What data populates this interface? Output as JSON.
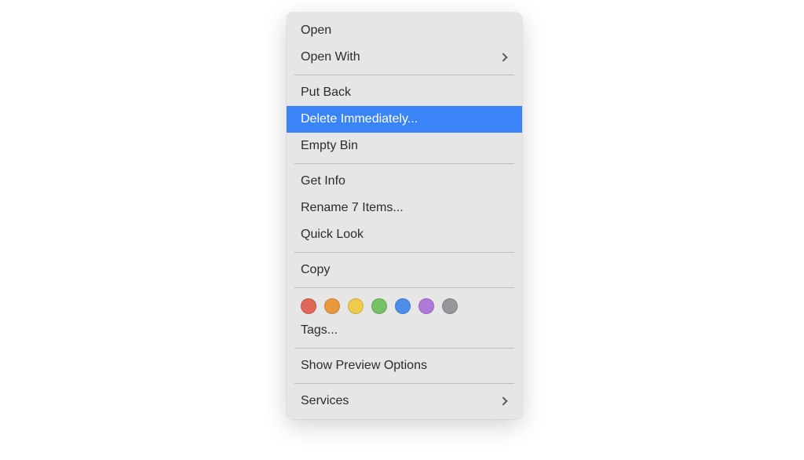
{
  "menu": {
    "open": "Open",
    "open_with": "Open With",
    "put_back": "Put Back",
    "delete_immediately": "Delete Immediately...",
    "empty_bin": "Empty Bin",
    "get_info": "Get Info",
    "rename_items": "Rename 7 Items...",
    "quick_look": "Quick Look",
    "copy": "Copy",
    "tags": "Tags...",
    "show_preview_options": "Show Preview Options",
    "services": "Services"
  },
  "colors": {
    "highlight": "#3a84f7",
    "menu_bg": "#e6e6e6",
    "text": "#2c2c2c"
  },
  "tag_colors": [
    "red",
    "orange",
    "yellow",
    "green",
    "blue",
    "purple",
    "gray"
  ]
}
